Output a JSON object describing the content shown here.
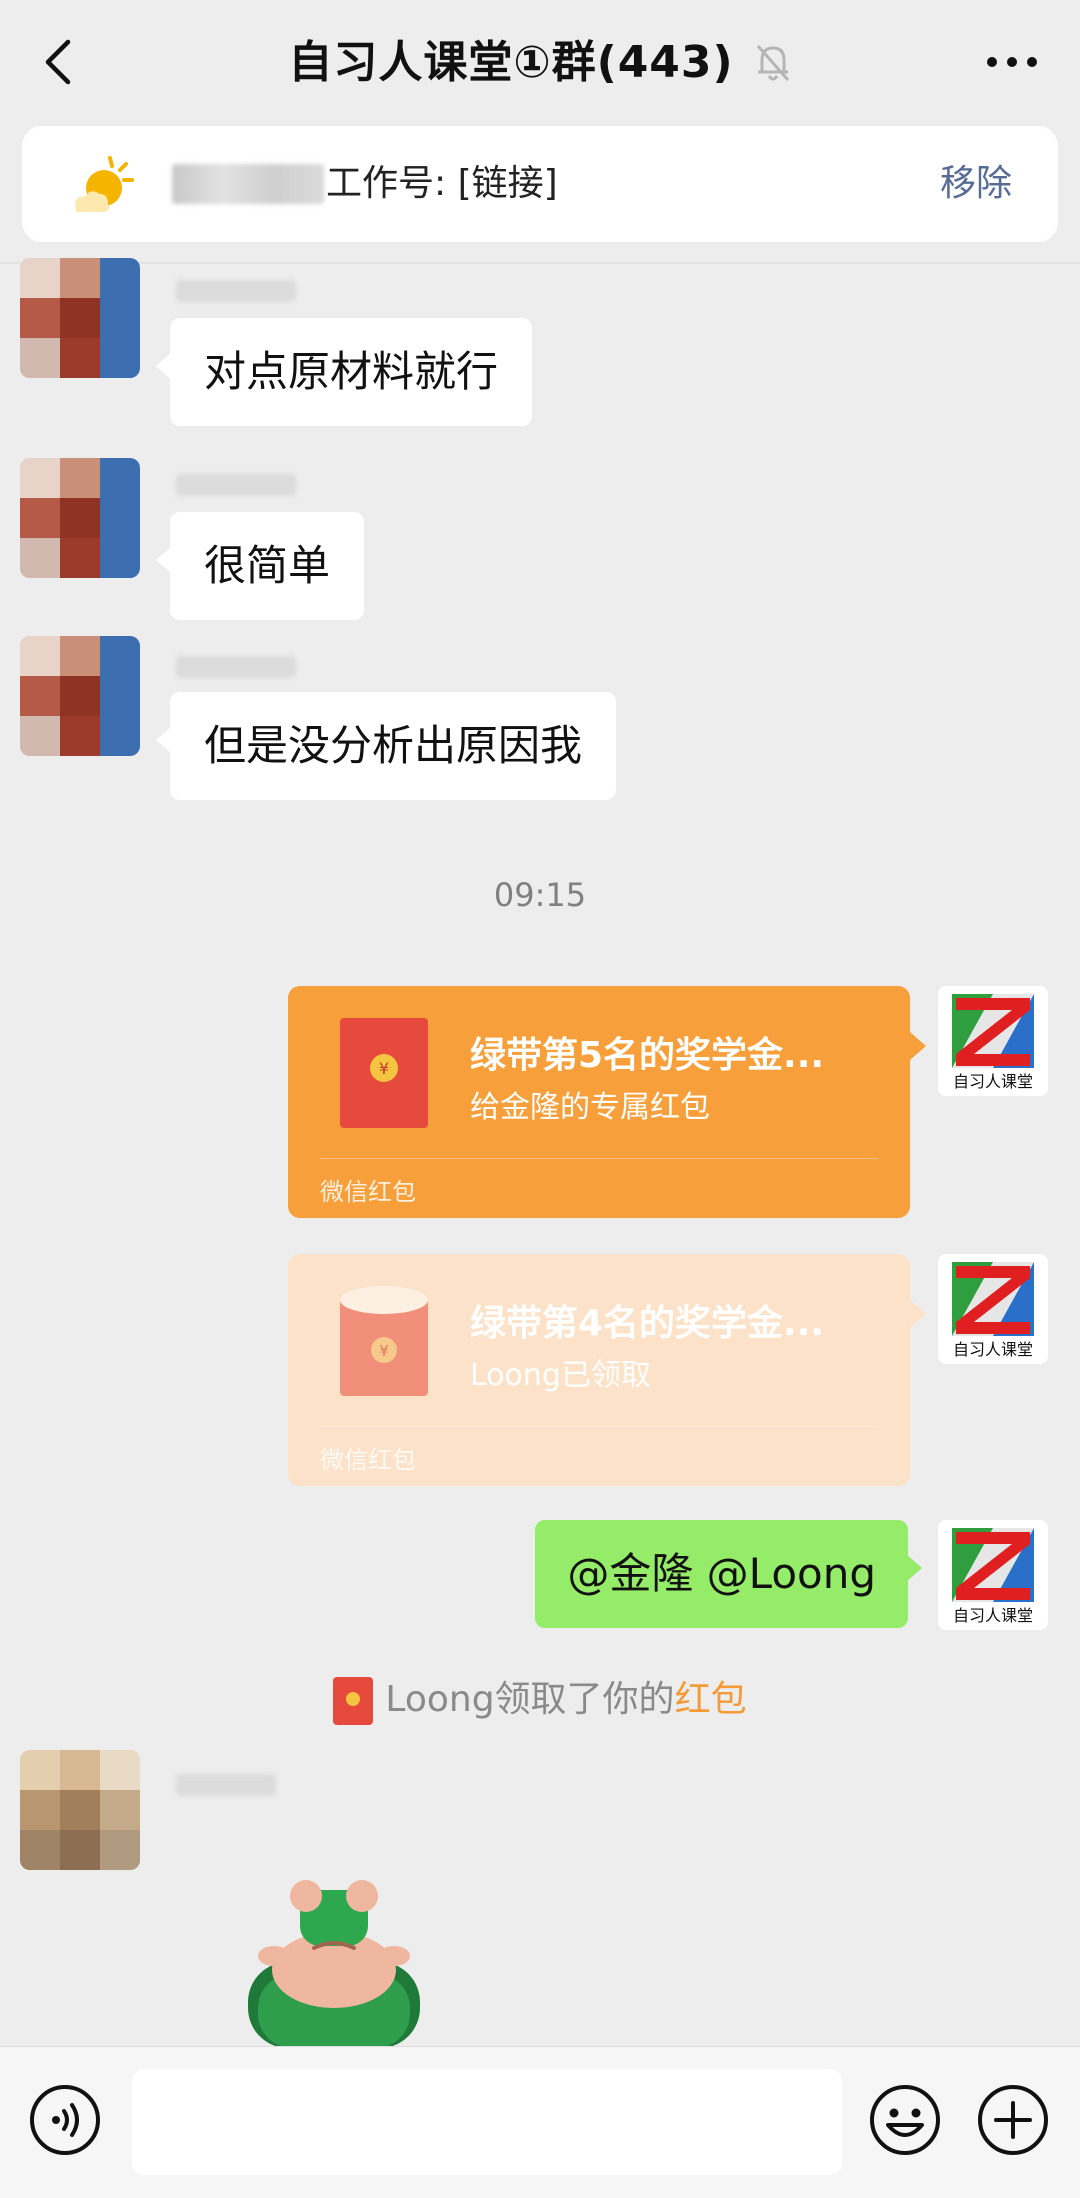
{
  "header": {
    "title": "自习人课堂①群(443)",
    "back_icon": "chevron-left-icon",
    "mute_icon": "bell-off-icon",
    "more_icon": "ellipsis-icon"
  },
  "pinned": {
    "text": "工作号: [链接]",
    "remove_label": "移除",
    "icon": "sun-cloud-icon"
  },
  "messages": [
    {
      "text": "对点原材料就行"
    },
    {
      "text": "很简单"
    },
    {
      "text": "但是没分析出原因我"
    }
  ],
  "time_label": "09:15",
  "red_packets": [
    {
      "title": "绿带第5名的奖学金...",
      "subtitle": "给金隆的专属红包",
      "footer": "微信红包",
      "status": "active"
    },
    {
      "title": "绿带第4名的奖学金...",
      "subtitle": "Loong已领取",
      "footer": "微信红包",
      "status": "claimed"
    }
  ],
  "self_avatar_label": "自习人课堂",
  "outgoing_message": "@金隆 @Loong",
  "system_message": {
    "prefix": "Loong领取了你的",
    "link": "红包"
  },
  "input": {
    "placeholder": ""
  },
  "colors": {
    "background": "#ededed",
    "bubble_out": "#95ec69",
    "red_packet_active": "#f79f3a",
    "red_packet_claimed": "#fce2c8",
    "link_blue": "#576b95",
    "link_orange": "#f49a37"
  }
}
